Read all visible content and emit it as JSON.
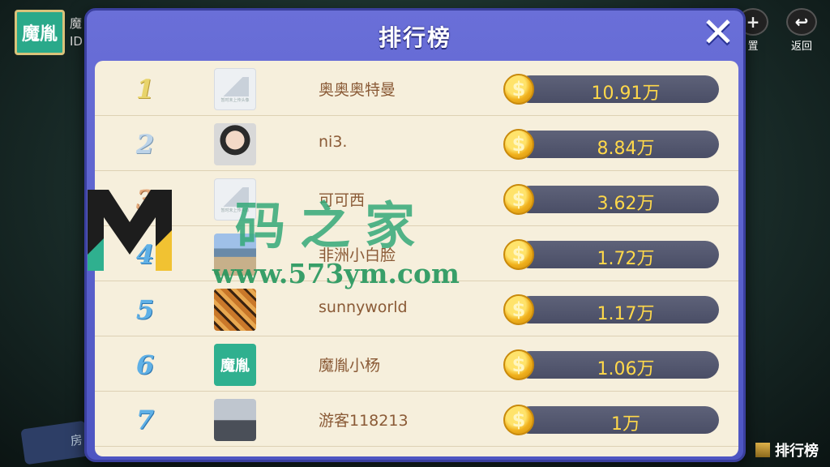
{
  "background": {
    "avatar_label": "魔胤",
    "info_line1": "魔",
    "info_line2": "ID",
    "settings_label": "置",
    "back_label": "返回",
    "bottom_left_label": "房",
    "bottom_right_label": "排行榜"
  },
  "modal": {
    "title": "排行榜",
    "close": "✕",
    "rows": [
      {
        "rank": "1",
        "name": "奥奥奥特曼",
        "score": "10.91万"
      },
      {
        "rank": "2",
        "name": "ni3.",
        "score": "8.84万"
      },
      {
        "rank": "3",
        "name": "可可西",
        "score": "3.62万"
      },
      {
        "rank": "4",
        "name": "非洲小白脸",
        "score": "1.72万"
      },
      {
        "rank": "5",
        "name": "sunnyworld",
        "score": "1.17万"
      },
      {
        "rank": "6",
        "name": "魔胤小杨",
        "score": "1.06万",
        "avatar_text": "魔胤"
      },
      {
        "rank": "7",
        "name": "游客118213",
        "score": "1万"
      }
    ],
    "placeholder_caption": "暂时未上传头像",
    "coin_symbol": "$"
  },
  "watermark": {
    "text": "码之家",
    "url": "www.573ym.com"
  }
}
